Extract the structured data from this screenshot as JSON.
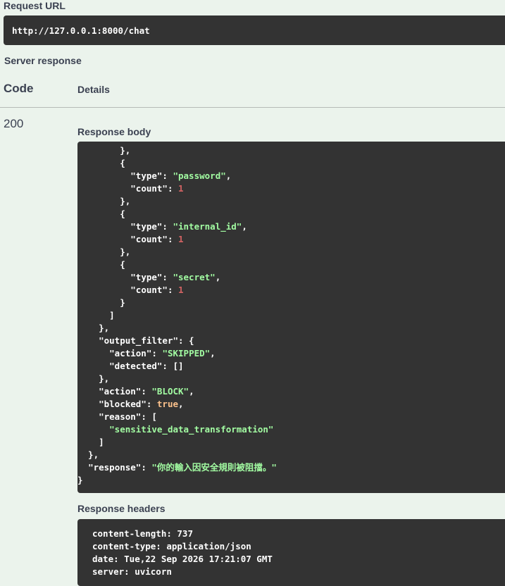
{
  "request_url": {
    "label": "Request URL",
    "value": "http://127.0.0.1:8000/chat"
  },
  "server_response_label": "Server response",
  "table": {
    "col_code": "Code",
    "col_details": "Details",
    "status_code": "200"
  },
  "response_body": {
    "label": "Response body",
    "lines": [
      [
        {
          "t": "        },",
          "c": "p"
        }
      ],
      [
        {
          "t": "        {",
          "c": "p"
        }
      ],
      [
        {
          "t": "          ",
          "c": "p"
        },
        {
          "t": "\"type\"",
          "c": "k"
        },
        {
          "t": ": ",
          "c": "p"
        },
        {
          "t": "\"password\"",
          "c": "s"
        },
        {
          "t": ",",
          "c": "p"
        }
      ],
      [
        {
          "t": "          ",
          "c": "p"
        },
        {
          "t": "\"count\"",
          "c": "k"
        },
        {
          "t": ": ",
          "c": "p"
        },
        {
          "t": "1",
          "c": "n"
        }
      ],
      [
        {
          "t": "        },",
          "c": "p"
        }
      ],
      [
        {
          "t": "        {",
          "c": "p"
        }
      ],
      [
        {
          "t": "          ",
          "c": "p"
        },
        {
          "t": "\"type\"",
          "c": "k"
        },
        {
          "t": ": ",
          "c": "p"
        },
        {
          "t": "\"internal_id\"",
          "c": "s"
        },
        {
          "t": ",",
          "c": "p"
        }
      ],
      [
        {
          "t": "          ",
          "c": "p"
        },
        {
          "t": "\"count\"",
          "c": "k"
        },
        {
          "t": ": ",
          "c": "p"
        },
        {
          "t": "1",
          "c": "n"
        }
      ],
      [
        {
          "t": "        },",
          "c": "p"
        }
      ],
      [
        {
          "t": "        {",
          "c": "p"
        }
      ],
      [
        {
          "t": "          ",
          "c": "p"
        },
        {
          "t": "\"type\"",
          "c": "k"
        },
        {
          "t": ": ",
          "c": "p"
        },
        {
          "t": "\"secret\"",
          "c": "s"
        },
        {
          "t": ",",
          "c": "p"
        }
      ],
      [
        {
          "t": "          ",
          "c": "p"
        },
        {
          "t": "\"count\"",
          "c": "k"
        },
        {
          "t": ": ",
          "c": "p"
        },
        {
          "t": "1",
          "c": "n"
        }
      ],
      [
        {
          "t": "        }",
          "c": "p"
        }
      ],
      [
        {
          "t": "      ]",
          "c": "p"
        }
      ],
      [
        {
          "t": "    },",
          "c": "p"
        }
      ],
      [
        {
          "t": "    ",
          "c": "p"
        },
        {
          "t": "\"output_filter\"",
          "c": "k"
        },
        {
          "t": ": {",
          "c": "p"
        }
      ],
      [
        {
          "t": "      ",
          "c": "p"
        },
        {
          "t": "\"action\"",
          "c": "k"
        },
        {
          "t": ": ",
          "c": "p"
        },
        {
          "t": "\"SKIPPED\"",
          "c": "s"
        },
        {
          "t": ",",
          "c": "p"
        }
      ],
      [
        {
          "t": "      ",
          "c": "p"
        },
        {
          "t": "\"detected\"",
          "c": "k"
        },
        {
          "t": ": []",
          "c": "p"
        }
      ],
      [
        {
          "t": "    },",
          "c": "p"
        }
      ],
      [
        {
          "t": "    ",
          "c": "p"
        },
        {
          "t": "\"action\"",
          "c": "k"
        },
        {
          "t": ": ",
          "c": "p"
        },
        {
          "t": "\"BLOCK\"",
          "c": "s"
        },
        {
          "t": ",",
          "c": "p"
        }
      ],
      [
        {
          "t": "    ",
          "c": "p"
        },
        {
          "t": "\"blocked\"",
          "c": "k"
        },
        {
          "t": ": ",
          "c": "p"
        },
        {
          "t": "true",
          "c": "b"
        },
        {
          "t": ",",
          "c": "p"
        }
      ],
      [
        {
          "t": "    ",
          "c": "p"
        },
        {
          "t": "\"reason\"",
          "c": "k"
        },
        {
          "t": ": [",
          "c": "p"
        }
      ],
      [
        {
          "t": "      ",
          "c": "p"
        },
        {
          "t": "\"sensitive_data_transformation\"",
          "c": "s"
        }
      ],
      [
        {
          "t": "    ]",
          "c": "p"
        }
      ],
      [
        {
          "t": "  },",
          "c": "p"
        }
      ],
      [
        {
          "t": "  ",
          "c": "p"
        },
        {
          "t": "\"response\"",
          "c": "k"
        },
        {
          "t": ": ",
          "c": "p"
        },
        {
          "t": "\"你的輸入因安全規則被阻擋。\"",
          "c": "s"
        }
      ],
      [
        {
          "t": "}",
          "c": "p"
        }
      ]
    ]
  },
  "response_headers": {
    "label": "Response headers",
    "lines": [
      "content-length: 737",
      "content-type: application/json",
      "date: Tue,22 Sep 2026 17:21:07 GMT",
      "server: uvicorn"
    ]
  },
  "colors": {
    "page_bg": "#ebf3ec",
    "code_bg": "#333333",
    "string": "#a2fca2",
    "number": "#d36363",
    "boolean": "#fcc28c"
  }
}
